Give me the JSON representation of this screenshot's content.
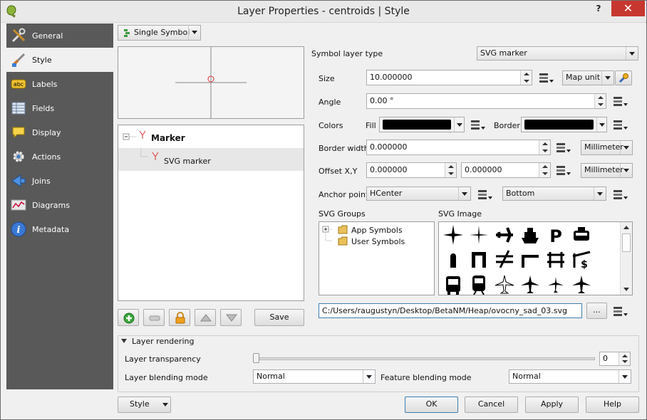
{
  "window": {
    "title": "Layer Properties - centroids | Style",
    "help_label": "?",
    "close_label": "✕"
  },
  "sidebar": {
    "items": [
      {
        "label": "General",
        "icon": "tools-icon"
      },
      {
        "label": "Style",
        "icon": "paintbrush-icon"
      },
      {
        "label": "Labels",
        "icon": "abc-label-icon"
      },
      {
        "label": "Fields",
        "icon": "table-fields-icon"
      },
      {
        "label": "Display",
        "icon": "speech-bubble-icon"
      },
      {
        "label": "Actions",
        "icon": "gear-actions-icon"
      },
      {
        "label": "Joins",
        "icon": "joins-arrow-icon"
      },
      {
        "label": "Diagrams",
        "icon": "diagram-icon"
      },
      {
        "label": "Metadata",
        "icon": "info-icon"
      }
    ],
    "active": "Style"
  },
  "renderer": {
    "label": "Single Symbol"
  },
  "symbol_tree": {
    "root": "Marker",
    "child": "SVG marker"
  },
  "symbol_buttons": {
    "save_label": "Save"
  },
  "symbol_layer_type": {
    "label": "Symbol layer type",
    "value": "SVG marker"
  },
  "props": {
    "size": {
      "label": "Size",
      "value": "10.000000",
      "unit": "Map unit"
    },
    "angle": {
      "label": "Angle",
      "value": "0.00 °"
    },
    "colors": {
      "label": "Colors",
      "fill_label": "Fill",
      "border_label": "Border",
      "fill_color": "#000000",
      "border_color": "#000000"
    },
    "border_width": {
      "label": "Border width",
      "value": "0.000000",
      "unit": "Millimeter"
    },
    "offset": {
      "label": "Offset X,Y",
      "x": "0.000000",
      "y": "0.000000",
      "unit": "Millimeter"
    },
    "anchor": {
      "label": "Anchor point",
      "h": "HCenter",
      "v": "Bottom"
    }
  },
  "svg_groups": {
    "label": "SVG Groups",
    "items": [
      "App Symbols",
      "User Symbols"
    ]
  },
  "svg_image": {
    "label": "SVG Image"
  },
  "svg_path": {
    "value": "C:/Users/raugustyn/Desktop/BetaNM/Heap/ovocny_sad_03.svg",
    "browse_label": "..."
  },
  "layer_rendering": {
    "title": "Layer rendering",
    "transparency_label": "Layer transparency",
    "transparency_value": "0",
    "blending_label": "Layer blending mode",
    "blending_value": "Normal",
    "feature_blending_label": "Feature blending mode",
    "feature_blending_value": "Normal"
  },
  "footer": {
    "style_label": "Style",
    "ok_label": "OK",
    "cancel_label": "Cancel",
    "apply_label": "Apply",
    "help_label": "Help"
  }
}
